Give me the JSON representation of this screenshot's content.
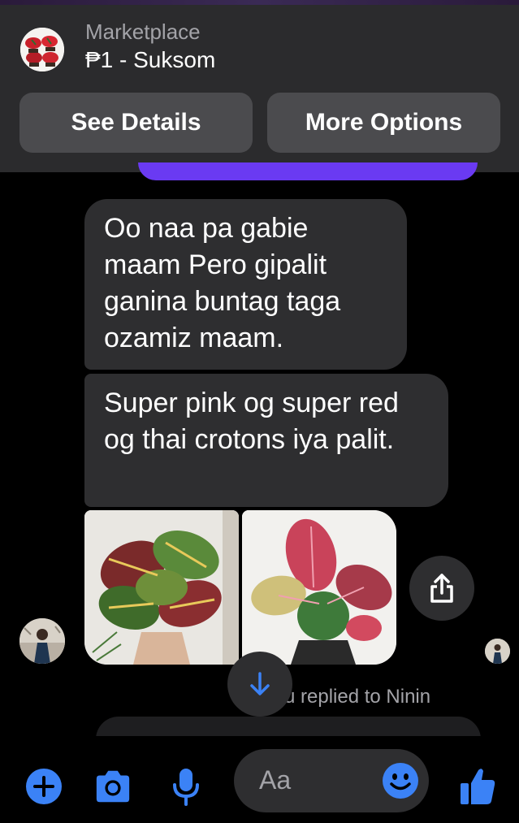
{
  "header": {
    "label": "Marketplace",
    "title": "₱1 - Suksom",
    "buttons": {
      "details": "See Details",
      "options": "More Options"
    }
  },
  "messages": [
    {
      "text": "Oo naa pa gabie maam Pero gipalit ganina buntag taga ozamiz maam."
    },
    {
      "text": "Super pink og super red og thai crotons iya palit."
    }
  ],
  "reply_notice": "u replied to Ninin",
  "composer": {
    "placeholder": "Aa"
  },
  "colors": {
    "accent": "#3b82f6",
    "bubble": "#2e2e30",
    "header_bg": "#2b2b2d",
    "button_bg": "#4b4b4e",
    "purple": "#6a3af2"
  },
  "icons": {
    "plus": "plus-icon",
    "camera": "camera-icon",
    "mic": "microphone-icon",
    "emoji": "emoji-icon",
    "like": "thumbs-up-icon",
    "share": "share-icon",
    "scroll": "arrow-down-icon"
  }
}
